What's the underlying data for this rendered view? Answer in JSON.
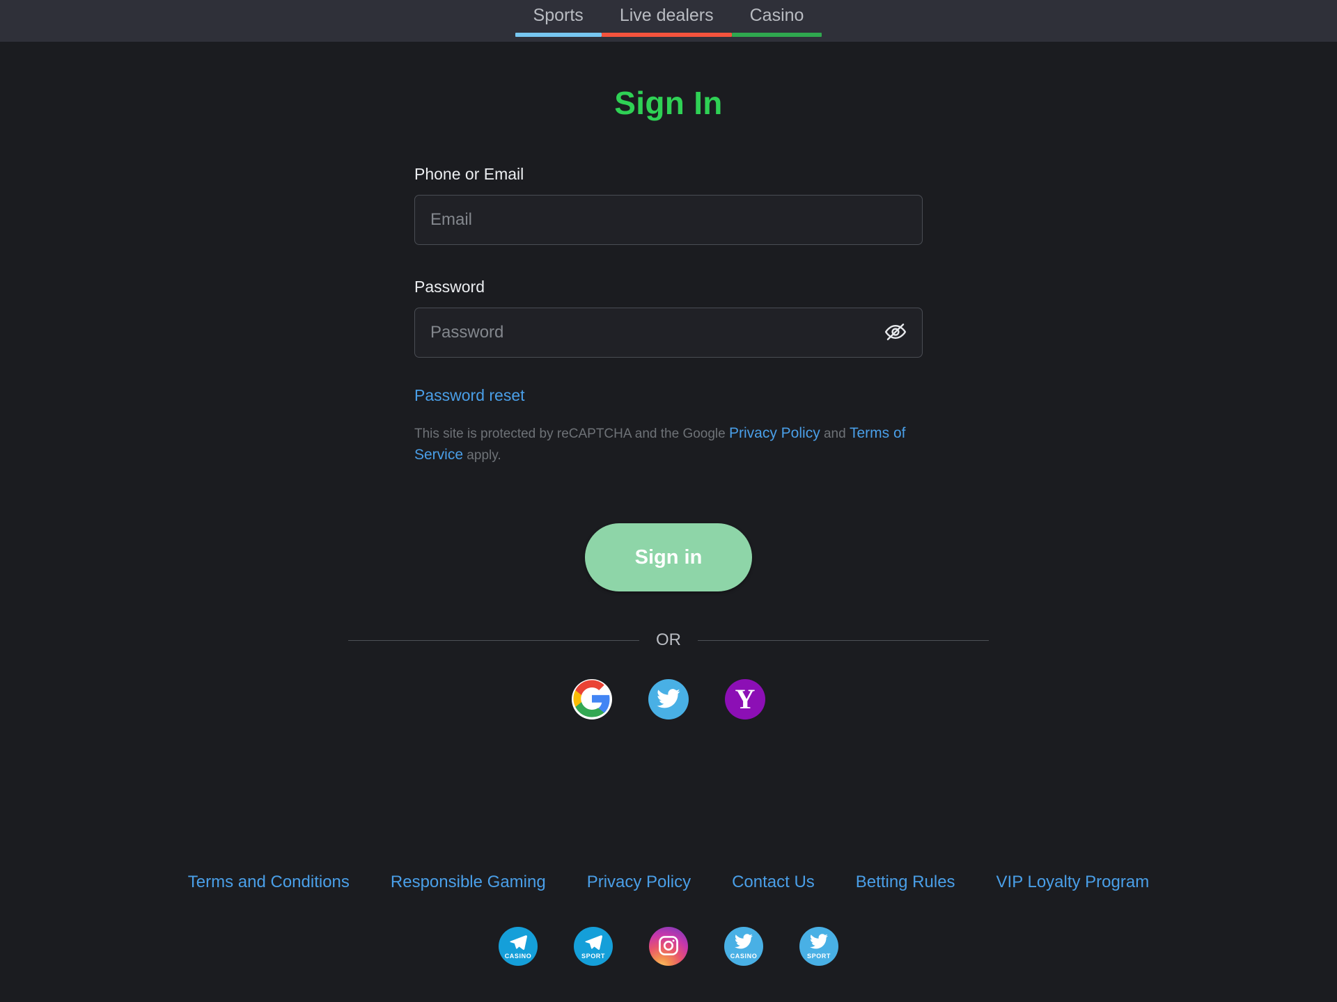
{
  "theme": {
    "page_bg": "#1b1c20",
    "topbar_bg": "#2f3039",
    "title_green": "#2fd155",
    "link_blue": "#4a9fe8",
    "button_green": "#8ed5a8",
    "input_border": "#4a4d54",
    "muted_text": "#6e7277"
  },
  "topnav": {
    "items": [
      {
        "label": "Sports",
        "accent": "#77c6f0"
      },
      {
        "label": "Live dealers",
        "accent": "#f4533d"
      },
      {
        "label": "Casino",
        "accent": "#2fa84f"
      }
    ]
  },
  "auth": {
    "title": "Sign In",
    "email": {
      "label": "Phone or Email",
      "placeholder": "Email",
      "value": ""
    },
    "password": {
      "label": "Password",
      "placeholder": "Password",
      "value": "",
      "toggle_icon": "eye-off-icon"
    },
    "password_reset_label": "Password reset",
    "recaptcha": {
      "prefix": "This site is protected by reCAPTCHA and the Google ",
      "privacy_policy": "Privacy Policy",
      "middle": " and ",
      "terms_of_service": "Terms of Service",
      "suffix": " apply."
    },
    "submit_label": "Sign in",
    "divider_label": "OR",
    "social_logins": [
      {
        "name": "google-icon",
        "label": "Google",
        "color": "#ffffff"
      },
      {
        "name": "twitter-icon",
        "label": "Twitter",
        "color": "#49b0e5"
      },
      {
        "name": "yahoo-icon",
        "label": "Yahoo",
        "color": "#8c0fb5",
        "glyph": "Y"
      }
    ]
  },
  "footer": {
    "links": [
      "Terms and Conditions",
      "Responsible Gaming",
      "Privacy Policy",
      "Contact Us",
      "Betting Rules",
      "VIP Loyalty Program"
    ],
    "socials": [
      {
        "icon": "telegram-icon",
        "caption": "CASINO",
        "color": "#159fd9"
      },
      {
        "icon": "telegram-icon",
        "caption": "SPORT",
        "color": "#159fd9"
      },
      {
        "icon": "instagram-icon",
        "caption": "",
        "color": "#c837ab"
      },
      {
        "icon": "twitter-icon",
        "caption": "CASINO",
        "color": "#49b0e5"
      },
      {
        "icon": "twitter-icon",
        "caption": "SPORT",
        "color": "#49b0e5"
      }
    ]
  }
}
